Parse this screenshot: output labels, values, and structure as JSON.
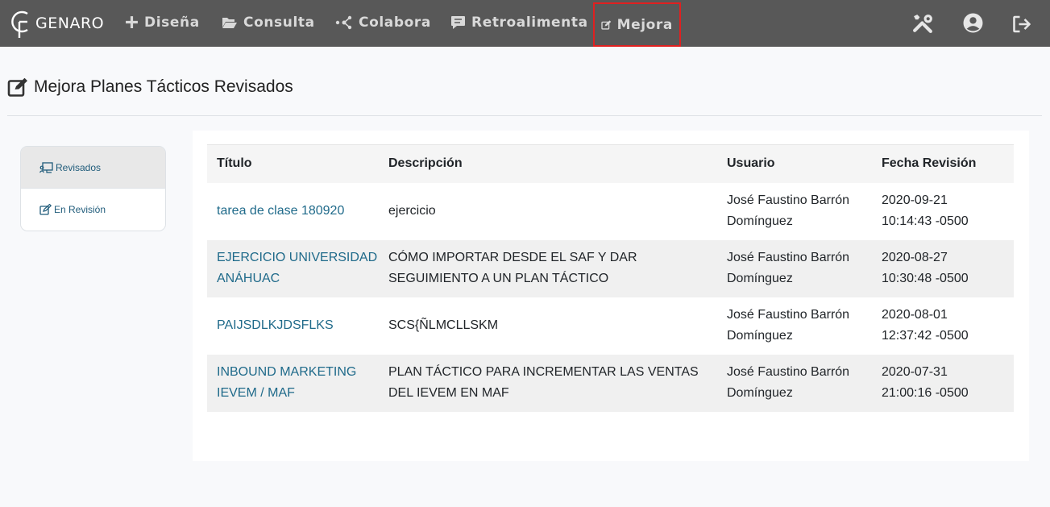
{
  "brand": {
    "name": "GENARO"
  },
  "nav": {
    "items": [
      {
        "label": "Diseña",
        "icon": "plus-icon"
      },
      {
        "label": "Consulta",
        "icon": "folder-open-icon"
      },
      {
        "label": "Colabora",
        "icon": "network-icon"
      },
      {
        "label": "Retroalimenta",
        "icon": "comment-icon"
      },
      {
        "label": "Mejora",
        "icon": "edit-icon",
        "active": true
      }
    ],
    "right_icons": [
      "tools-icon",
      "user-circle-icon",
      "logout-icon"
    ]
  },
  "page": {
    "title": "Mejora Planes Tácticos Revisados"
  },
  "sidebar": {
    "items": [
      {
        "label": "Revisados",
        "icon": "chalkboard-user-icon",
        "active": true
      },
      {
        "label": "En Revisión",
        "icon": "edit-icon",
        "active": false
      }
    ]
  },
  "table": {
    "headers": [
      "Título",
      "Descripción",
      "Usuario",
      "Fecha Revisión"
    ],
    "rows": [
      [
        "tarea de clase 180920",
        "ejercicio",
        "José Faustino Barrón Domínguez",
        "2020-09-21 10:14:43 -0500"
      ],
      [
        "EJERCICIO UNIVERSIDAD ANÁHUAC",
        "CÓMO IMPORTAR DESDE EL SAF Y DAR SEGUIMIENTO A UN PLAN TÁCTICO",
        "José Faustino Barrón Domínguez",
        "2020-08-27 10:30:48 -0500"
      ],
      [
        "PAIJSDLKJDSFLKS",
        "SCS{ÑLMCLLSKM",
        "José Faustino Barrón Domínguez",
        "2020-08-01 12:37:42 -0500"
      ],
      [
        "INBOUND MARKETING IEVEM / MAF",
        "PLAN TÁCTICO PARA INCREMENTAR LAS VENTAS DEL IEVEM EN MAF",
        "José Faustino Barrón Domínguez",
        "2020-07-31 21:00:16 -0500"
      ]
    ]
  },
  "colors": {
    "navbar": "#585858",
    "active_border": "#e02020",
    "link": "#1f6a8a"
  }
}
